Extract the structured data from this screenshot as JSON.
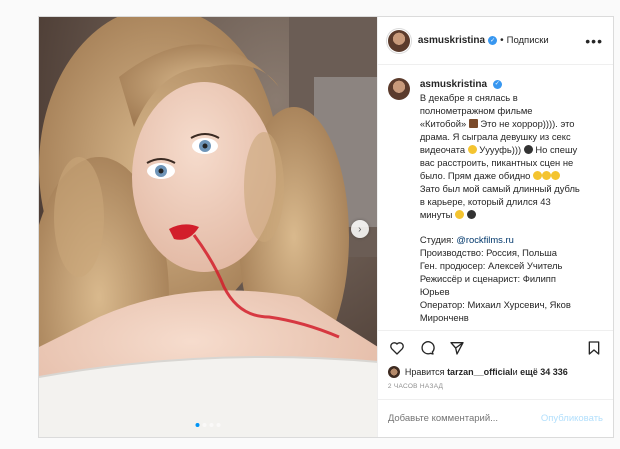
{
  "post": {
    "username": "asmuskristina",
    "header_separator": "•",
    "follow_label": "Подписки",
    "more_label": "•••",
    "caption_lines": [
      "В декабре я снялась в",
      "полнометражном фильме",
      "«Китобой»",
      "Это не хоррор)))). это",
      "драма. Я сыграла девушку из секс",
      "видеочата",
      "Ууууфь)))",
      "Но спешу",
      "вас расстроить, пикантных сцен не",
      "было. Прям даже обидно",
      "Зато был мой самый длинный дубль",
      "в карьере, который длился 43",
      "минуты"
    ],
    "credits": [
      "Студия: ",
      "@rockfilms.ru",
      "Производство: Россия, Польша",
      "Ген. продюсер: Алексей Учитель",
      "Режиссёр и сценарист: Филипп",
      "Юрьев",
      "Оператор: Михаил Хурсевич, Яков",
      "Миронченв"
    ],
    "likes_prefix": "Нравится ",
    "likes_user": "tarzan__official",
    "likes_mid": " и ",
    "likes_count": "ещё 34 336",
    "time_ago": "2 ЧАСОВ НАЗАД",
    "comment_placeholder": "Добавьте комментарий...",
    "publish_label": "Опубликовать"
  },
  "icons": [
    "verified-badge-icon",
    "heart-icon",
    "comment-icon",
    "share-icon",
    "bookmark-icon",
    "next-arrow-icon"
  ],
  "carousel": {
    "slides": 4,
    "active_index": 0
  },
  "colors": {
    "accent": "#0095f6",
    "verified": "#3897f0",
    "publish_disabled": "#b2dffc"
  }
}
